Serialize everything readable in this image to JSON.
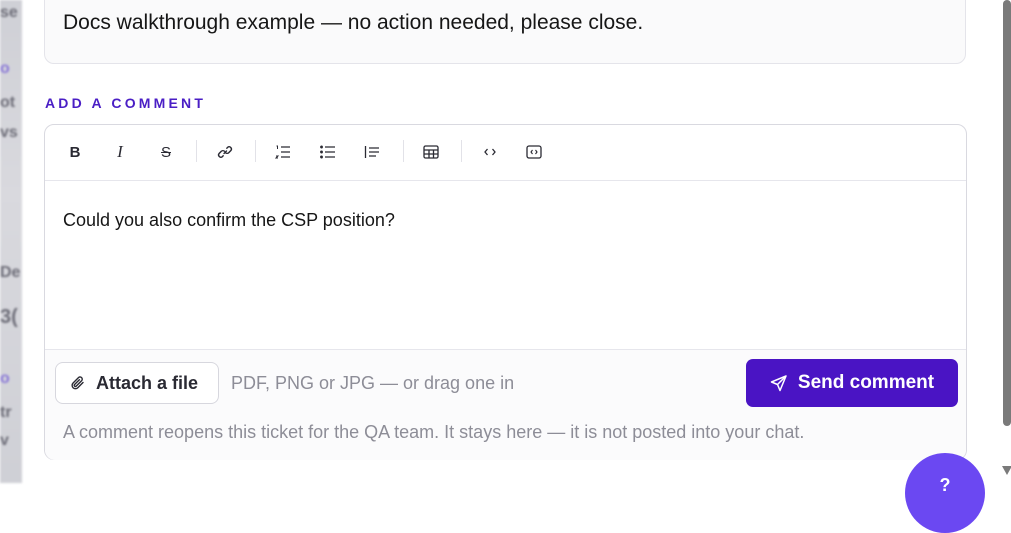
{
  "ticket": {
    "description": "Docs walkthrough example — no action needed, please close."
  },
  "comment_section": {
    "label": "ADD A COMMENT",
    "toolbar": [
      {
        "name": "bold-button",
        "glyph": "B"
      },
      {
        "name": "italic-button",
        "glyph": "I"
      },
      {
        "name": "strikethrough-button",
        "glyph": "S"
      },
      {
        "name": "link-button",
        "glyph": "link"
      },
      {
        "name": "ordered-list-button",
        "glyph": "ol"
      },
      {
        "name": "bullet-list-button",
        "glyph": "ul"
      },
      {
        "name": "blockquote-button",
        "glyph": "quote"
      },
      {
        "name": "table-button",
        "glyph": "table"
      },
      {
        "name": "code-inline-button",
        "glyph": "code"
      },
      {
        "name": "code-block-button",
        "glyph": "codeblock"
      }
    ],
    "draft_text": "Could you also confirm the CSP position?",
    "attach_label": "Attach a file",
    "attach_hint": "PDF, PNG or JPG — or drag one in",
    "send_label": "Send comment",
    "footnote": "A comment reopens this ticket for the QA team. It stays here — it is not posted into your chat."
  },
  "fab": {
    "label": "?"
  },
  "colors": {
    "accent": "#4a14c4",
    "label_accent": "#4a1ec5",
    "fab": "#6b48f2"
  }
}
